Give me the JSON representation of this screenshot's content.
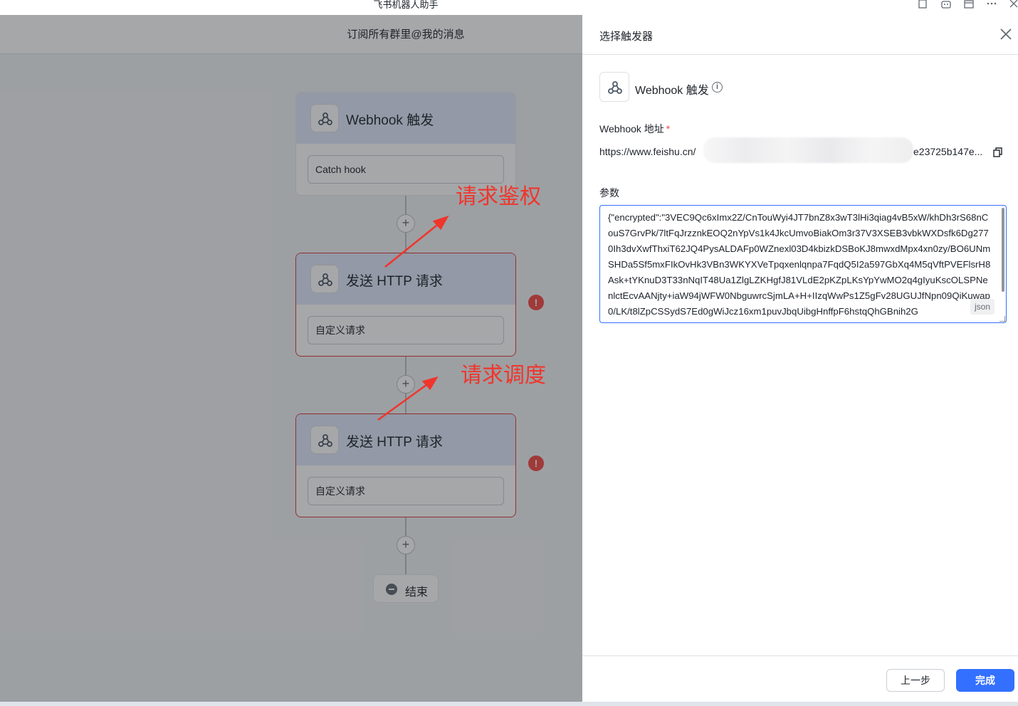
{
  "window": {
    "title": "飞书机器人助手"
  },
  "flow": {
    "title": "订阅所有群里@我的消息",
    "nodes": [
      {
        "title": "Webhook 触发",
        "field": "Catch hook",
        "error": false
      },
      {
        "title": "发送 HTTP 请求",
        "field": "自定义请求",
        "error": true
      },
      {
        "title": "发送 HTTP 请求",
        "field": "自定义请求",
        "error": true
      }
    ],
    "add_symbol": "+",
    "error_symbol": "!",
    "end_label": "结束"
  },
  "annotations": {
    "auth": "请求鉴权",
    "schedule": "请求调度",
    "color": "#f0352c"
  },
  "drawer": {
    "title": "选择触发器",
    "trigger_name": "Webhook 触发",
    "info_symbol": "i",
    "webhook_label": "Webhook 地址",
    "required_mark": "*",
    "url_visible_start": "https://www.feishu.cn/",
    "url_visible_end": "e23725b147e...",
    "params_label": "参数",
    "params_value": "{\"encrypted\":\"3VEC9Qc6xImx2Z/CnTouWyi4JT7bnZ8x3wT3lHi3qiag4vB5xW/khDh3rS68nCouS7GrvPk/7ltFqJrzznkEOQ2nYpVs1k4JkcUmvoBiakOm3r37V3XSEB3vbkWXDsfk6Dg2770Ih3dvXwfThxiT62JQ4PysALDAFp0WZnexl03D4kbizkDSBoKJ8mwxdMpx4xn0zy/BO6UNmSHDa5Sf5mxFIkOvHk3VBn3WKYXVeTpqxenlqnpa7FqdQ5I2a597GbXq4M5qVftPVEFlsrH8Ask+tYKnuD3T33nNqIT48Ua1ZlgLZKHgfJ81VLdE2pKZpLKsYpYwMO2q4gIyuKscOLSPNenlctEcvAANjty+iaW94jWFW0NbguwrcSjmLA+H+IIzqWwPs1Z5gFv28UGUJfNpn09QiKuwap0/LK/t8lZpCSSydS7Ed0gWiJcz16xm1puvJbqUibgHnffpF6hstqQhGBnih2G",
    "params_format": "json",
    "btn_prev": "上一步",
    "btn_done": "完成",
    "accent": "#3370ff"
  }
}
